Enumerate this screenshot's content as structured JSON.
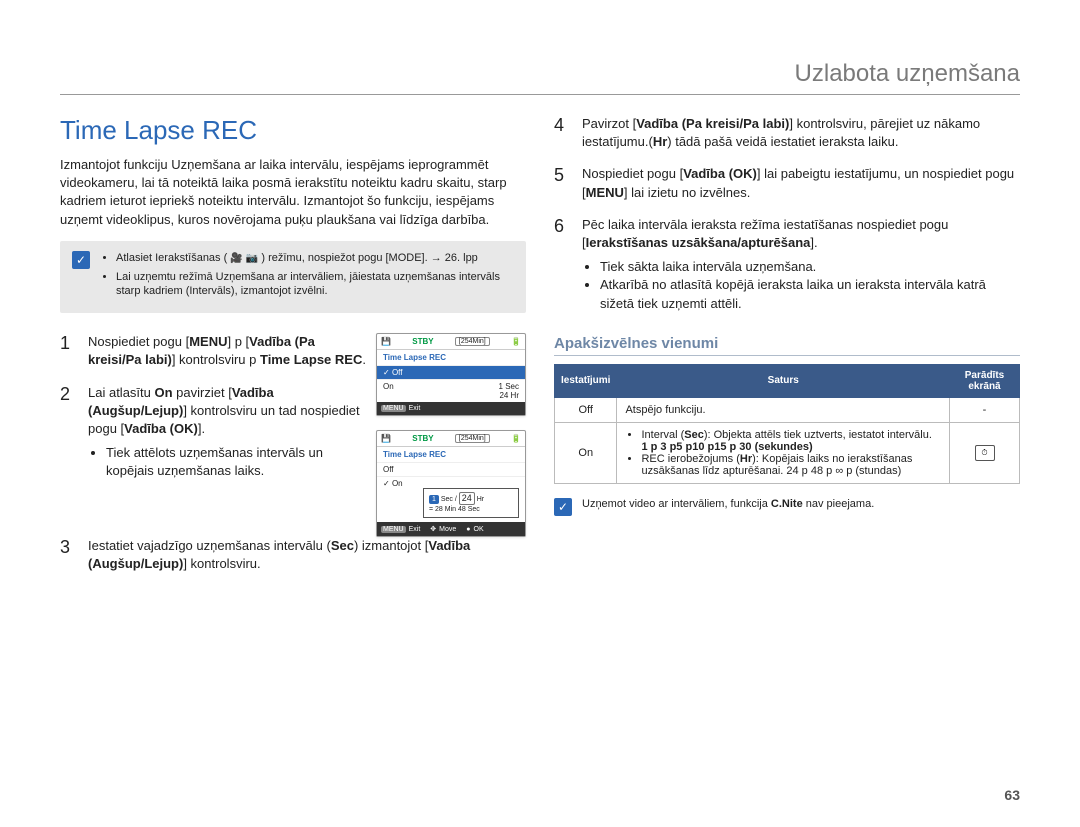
{
  "header": {
    "title": "Uzlabota uzņemšana"
  },
  "left": {
    "h1": "Time Lapse REC",
    "intro": "Izmantojot funkciju Uzņemšana ar laika intervālu, iespējams ieprogrammēt videokameru, lai tā noteiktā laika posmā ierakstītu noteiktu kadru skaitu, starp kadriem ieturot iepriekš noteiktu intervālu. Izmantojot šo funkciju, iespējams uzņemt videoklipus, kuros novērojama puķu plaukšana vai līdzīga darbība.",
    "note": {
      "item1_pre": "Atlasiet Ierakstīšanas (",
      "item1_post": ") režīmu, nospiežot pogu [MODE]. → 26. lpp",
      "item2": "Lai uzņemtu režīmā Uzņemšana ar intervāliem, jāiestata uzņemšanas intervāls starp kadriem (Intervāls), izmantojot izvēlni."
    },
    "steps": {
      "s1": {
        "num": "1",
        "html_parts": {
          "a": "Nospiediet pogu [",
          "b": "MENU",
          "c": "] p [",
          "d": "Vadība (Pa kreisi/Pa labi)",
          "e": "] kontrolsviru p ",
          "f": "Time Lapse REC",
          "g": "."
        }
      },
      "s2": {
        "num": "2",
        "parts": {
          "a": "Lai atlasītu ",
          "b": "On",
          "c": " pavirziet [",
          "d": "Vadība (Augšup/Lejup)",
          "e": "] kontrolsviru un tad nospiediet pogu [",
          "f": "Vadība (OK)",
          "g": "]."
        },
        "bullet": "Tiek attēlots uzņemšanas intervāls un kopējais uzņemšanas laiks."
      },
      "s3": {
        "num": "3",
        "parts": {
          "a": "Iestatiet vajadzīgo uzņemšanas intervālu (",
          "b": "Sec",
          "c": ") izmantojot [",
          "d": "Vadība (Augšup/Lejup)",
          "e": "] kontrolsviru."
        }
      }
    },
    "ss1": {
      "stby": "STBY",
      "time": "[254Min]",
      "title": "Time Lapse REC",
      "off": "Off",
      "on": "On",
      "right1": "1 Sec",
      "right2": "24 Hr",
      "exit": "Exit"
    },
    "ss2": {
      "stby": "STBY",
      "time": "[254Min]",
      "title": "Time Lapse REC",
      "off": "Off",
      "on": "On",
      "pop_sec": "Sec /",
      "pop_1": "1",
      "pop_hr": "24",
      "pop_hr_lbl": "Hr",
      "pop_eq": "= 28 Min 48 Sec",
      "exit": "Exit",
      "move": "Move",
      "ok": "OK"
    }
  },
  "right": {
    "steps": {
      "s4": {
        "num": "4",
        "parts": {
          "a": "Pavirzot [",
          "b": "Vadība (Pa kreisi/Pa labi)",
          "c": "] kontrolsviru, pārejiet uz nākamo iestatījumu.(",
          "d": "Hr",
          "e": ") tādā pašā veidā iestatiet ieraksta laiku."
        }
      },
      "s5": {
        "num": "5",
        "parts": {
          "a": "Nospiediet pogu [",
          "b": "Vadība (OK)",
          "c": "] lai pabeigtu iestatījumu, un nospiediet pogu [",
          "d": "MENU",
          "e": "] lai izietu no izvēlnes."
        }
      },
      "s6": {
        "num": "6",
        "parts": {
          "a": "Pēc laika intervāla ieraksta režīma iestatīšanas nospiediet pogu [",
          "b": "Ierakstīšanas uzsākšana/apturēšana",
          "c": "]."
        },
        "bullets": {
          "b1": "Tiek sākta laika intervāla uzņemšana.",
          "b2": "Atkarībā no atlasītā kopējā ieraksta laika un ieraksta intervāla katrā sižetā tiek uzņemti attēli."
        }
      }
    },
    "subheader": "Apakšizvēlnes vienumi",
    "table": {
      "th1": "Iestatījumi",
      "th2": "Saturs",
      "th3": "Parādīts ekrānā",
      "row1": {
        "c1": "Off",
        "c2": "Atspējo funkciju.",
        "c3": "-"
      },
      "row2": {
        "c1": "On",
        "b1_pre": "Interval (",
        "b1_sec": "Sec",
        "b1_post": "): Objekta attēls tiek uztverts, iestatot intervālu.",
        "b1_line2": "1 p 3 p5 p10 p15 p 30 (sekundes)",
        "b2_pre": "REC ierobežojums (",
        "b2_hr": "Hr",
        "b2_post": "): Kopējais laiks no ierakstīšanas uzsākšanas līdz apturēšanai. 24 p 48 p ∞ p (stundas)"
      }
    },
    "footnote": {
      "text_pre": "Uzņemot video ar intervāliem, funkcija ",
      "text_b": "C.Nite",
      "text_post": " nav pieejama."
    }
  },
  "page_number": "63"
}
